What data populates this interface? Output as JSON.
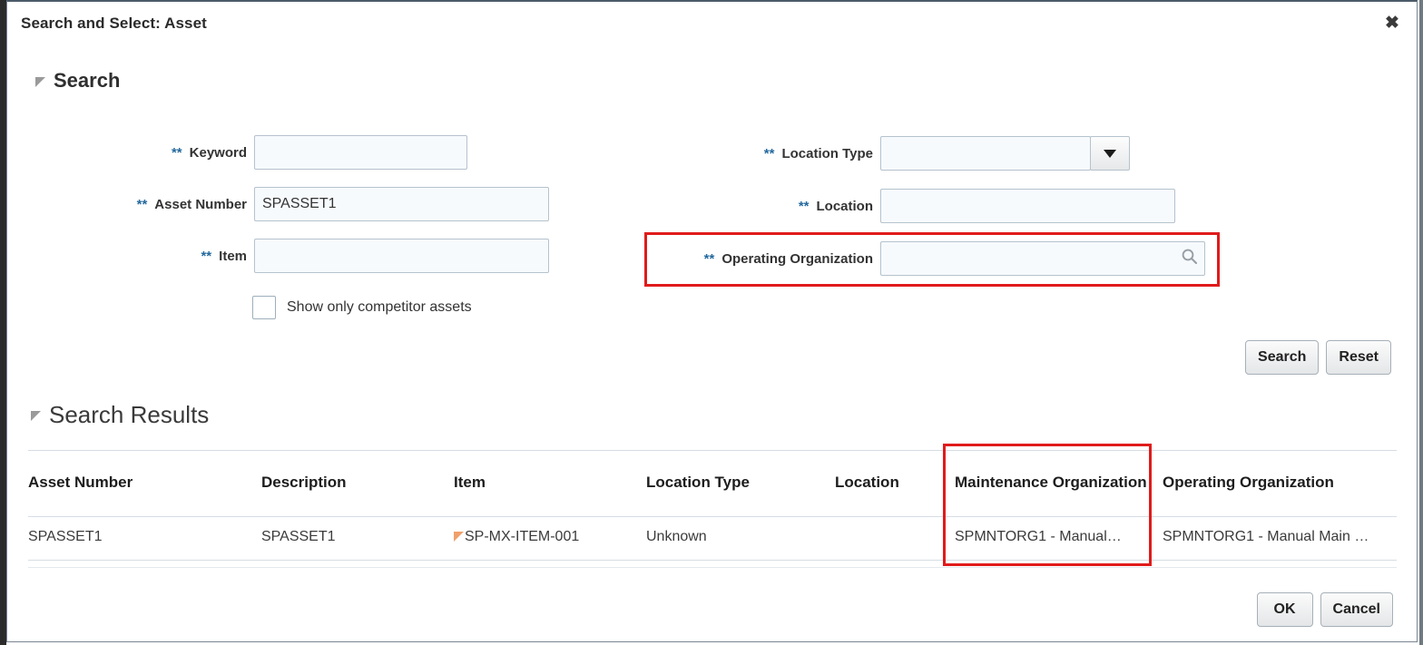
{
  "dialog": {
    "title": "Search and Select: Asset",
    "close_icon": "close-icon"
  },
  "search_section": {
    "heading": "Search",
    "required_mark": "**",
    "fields_left": [
      {
        "label": "Keyword",
        "value": "",
        "placeholder": ""
      },
      {
        "label": "Asset Number",
        "value": "SPASSET1",
        "placeholder": ""
      },
      {
        "label": "Item",
        "value": "",
        "placeholder": ""
      }
    ],
    "fields_right": [
      {
        "label": "Location Type",
        "value": "",
        "placeholder": "",
        "control": "dropdown"
      },
      {
        "label": "Location",
        "value": "",
        "placeholder": "",
        "control": "text"
      },
      {
        "label": "Operating Organization",
        "value": "",
        "placeholder": "",
        "control": "lov"
      }
    ],
    "checkbox": {
      "label": "Show only competitor assets",
      "checked": false
    },
    "buttons": [
      {
        "label": "Search"
      },
      {
        "label": "Reset"
      }
    ]
  },
  "results_section": {
    "heading": "Search Results",
    "columns": [
      "Asset Number",
      "Description",
      "Item",
      "Location Type",
      "Location",
      "Maintenance Organization",
      "Operating Organization"
    ],
    "rows": [
      {
        "asset_number": "SPASSET1",
        "description": "SPASSET1",
        "item": "SP-MX-ITEM-001",
        "item_flag": "warning-flag-icon",
        "location_type": "Unknown",
        "location": "",
        "maintenance_organization": "SPMNTORG1 - Manual…",
        "operating_organization": "SPMNTORG1 - Manual Main …"
      }
    ]
  },
  "footer": {
    "buttons": [
      {
        "label": "OK"
      },
      {
        "label": "Cancel"
      }
    ]
  },
  "annotations": {
    "highlight_color": "#e01b1b",
    "boxes": [
      {
        "target": "Operating Organization field"
      },
      {
        "target": "Maintenance Organization column"
      }
    ]
  }
}
